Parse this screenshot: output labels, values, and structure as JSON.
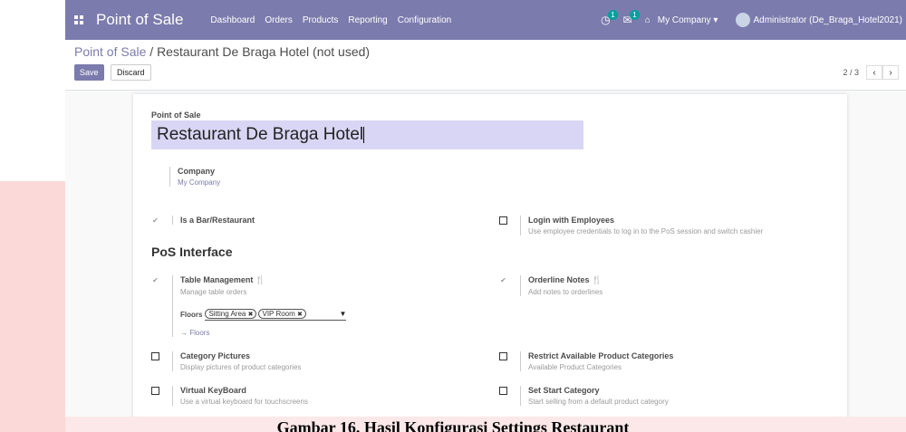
{
  "topbar": {
    "brand": "Point of Sale",
    "menu": [
      "Dashboard",
      "Orders",
      "Products",
      "Reporting",
      "Configuration"
    ],
    "activity_badge": "1",
    "messages_badge": "1",
    "company": "My Company ▾",
    "user": "Administrator (De_Braga_Hotel2021)"
  },
  "breadcrumb": {
    "root": "Point of Sale",
    "separator": " / ",
    "current": "Restaurant De Braga Hotel (not used)"
  },
  "actions": {
    "save": "Save",
    "discard": "Discard"
  },
  "pager": {
    "count": "2 / 3",
    "prev": "‹",
    "next": "›"
  },
  "form": {
    "name_label": "Point of Sale",
    "name_value": "Restaurant De Braga Hotel",
    "company_label": "Company",
    "company_value": "My Company",
    "section_title": "PoS Interface",
    "settings": {
      "bar_restaurant": {
        "label": "Is a Bar/Restaurant",
        "checked": true
      },
      "login_employees": {
        "label": "Login with Employees",
        "desc": "Use employee credentials to log in to the PoS session and switch cashier",
        "checked": false
      },
      "table_management": {
        "label": "Table Management",
        "desc": "Manage table orders",
        "checked": true
      },
      "orderline_notes": {
        "label": "Orderline Notes",
        "desc": "Add notes to orderlines",
        "checked": true
      },
      "category_pictures": {
        "label": "Category Pictures",
        "desc": "Display pictures of product categories",
        "checked": false
      },
      "restrict_categories": {
        "label": "Restrict Available Product Categories",
        "desc": "Available Product Categories",
        "checked": false
      },
      "virtual_keyboard": {
        "label": "Virtual KeyBoard",
        "desc": "Use a virtual keyboard for touchscreens",
        "checked": false
      },
      "start_category": {
        "label": "Set Start Category",
        "desc": "Start selling from a default product category",
        "checked": false
      }
    },
    "floors": {
      "label": "Floors",
      "tags": [
        "Sitting Area",
        "VIP Room"
      ],
      "link": "→ Floors"
    }
  },
  "caption": "Gambar 16. Hasil Konfigurasi Settings Restaurant",
  "colors": {
    "primary": "#7c7bad",
    "title_bg": "#d8d6f4",
    "accent_badge": "#00a09d"
  }
}
